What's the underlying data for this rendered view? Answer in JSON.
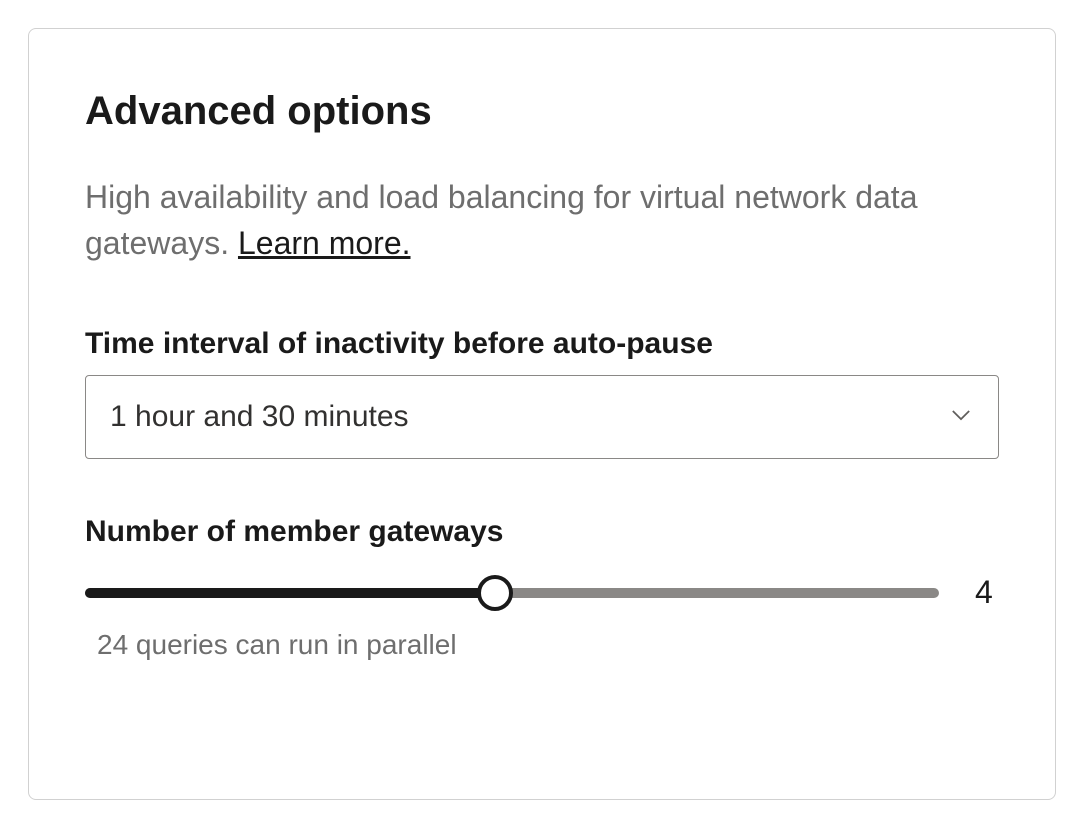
{
  "panel": {
    "title": "Advanced options",
    "description_prefix": "High availability and load balancing for virtual network data gateways. ",
    "learn_more_label": "Learn more."
  },
  "autopause": {
    "label": "Time interval of inactivity before auto-pause",
    "selected": "1 hour and 30 minutes"
  },
  "gateways": {
    "label": "Number of member gateways",
    "value": "4",
    "caption": "24 queries can run in parallel"
  }
}
